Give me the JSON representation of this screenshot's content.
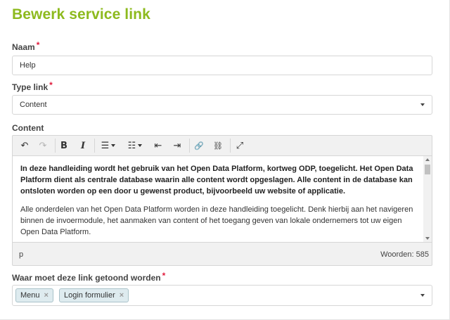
{
  "page": {
    "title": "Bewerk service link"
  },
  "fields": {
    "naam": {
      "label": "Naam",
      "required_mark": "*",
      "value": "Help"
    },
    "type_link": {
      "label": "Type link",
      "required_mark": "*",
      "value": "Content"
    },
    "content": {
      "label": "Content"
    },
    "waar": {
      "label": "Waar moet deze link getoond worden",
      "required_mark": "*",
      "tags": [
        {
          "label": "Menu",
          "remove": "×"
        },
        {
          "label": "Login formulier",
          "remove": "×"
        }
      ]
    }
  },
  "editor": {
    "toolbar": {
      "undo": "↶",
      "redo": "↷",
      "bold": "B",
      "italic": "I",
      "bullet_list": "☰",
      "numbered_list": "☷",
      "outdent": "⇤",
      "indent": "⇥",
      "link": "🔗",
      "unlink": "⛓",
      "fullscreen": "⤢"
    },
    "paragraph1": "In deze handleiding wordt het gebruik van het Open Data Platform, kortweg ODP, toegelicht. Het Open Data Platform dient als centrale database waarin alle content wordt opgeslagen. Alle content in de database kan ontsloten worden op een door u gewenst product, bijvoorbeeld uw website of applicatie.",
    "paragraph2": "Alle onderdelen van het Open Data Platform worden in deze handleiding toegelicht. Denk hierbij aan het navigeren binnen de invoermodule, het aanmaken van content of het toegang geven van lokale ondernemers tot uw eigen Open Data Platform.",
    "status_path": "p",
    "word_count": "Woorden: 585"
  },
  "colors": {
    "title": "#8dba1e",
    "required": "#e01b3c",
    "tag_bg": "#deebef"
  }
}
